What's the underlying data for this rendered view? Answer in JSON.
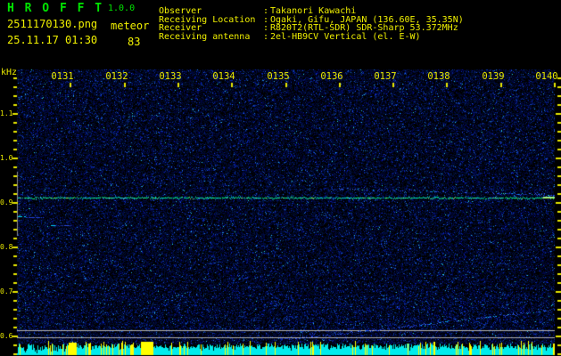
{
  "ui_colors": {
    "background": "#000000",
    "title_green": "#00e400",
    "text_yellow": "#f0f000",
    "axis_yellow": "#e8e800",
    "bar_cyan": "#00ecec",
    "spike_yellow": "#ffff00",
    "level_line_gray": "#b0b0b0",
    "band_marker_gray": "#8a8a8a",
    "carrier_green": "#00e87c"
  },
  "header": {
    "app_name": "H R O F F T",
    "version": "1.0.0",
    "filename": "2511170130.png",
    "mode": "meteor",
    "datetime": "25.11.17 01:30",
    "count": "83",
    "colon": ":",
    "info": [
      {
        "label": "Observer",
        "value": "Takanori Kawachi"
      },
      {
        "label": "Receiving Location",
        "value": "Ogaki, Gifu, JAPAN (136.60E, 35.35N)"
      },
      {
        "label": "Receiver",
        "value": "R820T2(RTL-SDR) SDR-Sharp 53.372MHz"
      },
      {
        "label": "Receiving antenna",
        "value": "2el-HB9CV Vertical (el. E-W)"
      }
    ]
  },
  "chart_data": {
    "type": "heatmap",
    "subtype": "radio-meteor-echo-spectrogram",
    "title": "",
    "x_axis": {
      "unit": "time HHMM",
      "tick_labels": [
        "0131",
        "0132",
        "0133",
        "0134",
        "0135",
        "0136",
        "0137",
        "0138",
        "0139",
        "0140"
      ]
    },
    "y_axis": {
      "label": "kHz",
      "tick_labels": [
        "1.1",
        "1.0",
        "0.9",
        "0.8",
        "0.7",
        "0.6"
      ],
      "tick_values_khz": [
        1.1,
        1.0,
        0.9,
        0.8,
        0.7,
        0.6
      ],
      "minor_step_khz": 0.02,
      "visible_range_khz": [
        0.56,
        1.18
      ]
    },
    "features": {
      "carrier_line": {
        "khz": 0.912,
        "start_min": 0,
        "end_min": 10.0
      },
      "upper_echo_trace": {
        "start": {
          "min": 5.9,
          "khz": 0.932
        },
        "end": {
          "min": 10.05,
          "khz": 0.918
        }
      },
      "lower_echo_trace": {
        "start": {
          "min": 5.2,
          "khz": 0.596
        },
        "end": {
          "min": 10.1,
          "khz": 0.662
        }
      },
      "short_echo_a": {
        "start": {
          "min": 0.0,
          "khz": 0.871
        },
        "end": {
          "min": 0.5,
          "khz": 0.869
        }
      },
      "short_echo_b": {
        "start": {
          "min": 0.6,
          "khz": 0.851
        },
        "end": {
          "min": 1.0,
          "khz": 0.849
        }
      },
      "detection_band_marker_khz": [
        0.826,
        0.97
      ],
      "level_reference_lines_khz": [
        0.614,
        0.598
      ]
    },
    "activity_bars": {
      "meaning": "per-second signal level strip along bottom; cyan = noise level, yellow = stronger echo spikes",
      "base_color": "#00ecec",
      "spike_color": "#ffff00"
    }
  }
}
